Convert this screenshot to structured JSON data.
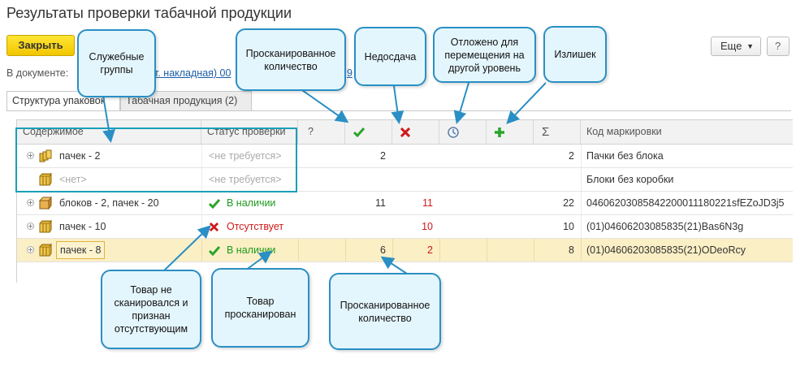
{
  "window": {
    "title": "Результаты проверки табачной продукции"
  },
  "toolbar": {
    "close_label": "Закрыть",
    "more_label": "Еще",
    "help_label": "?"
  },
  "document": {
    "label": "В документе:",
    "link_left": "т. накладная) 00",
    "link_right": "9"
  },
  "tabs": [
    {
      "label": "Структура упаковок"
    },
    {
      "label": "Табачная продукция (2)"
    }
  ],
  "table": {
    "headers": {
      "content": "Содержимое",
      "status": "Статус проверки",
      "unknown": "?",
      "sum": "Σ",
      "code": "Код маркировки"
    },
    "rows": [
      {
        "content": "пачек -  2",
        "status": "<не требуется>",
        "scanned": "2",
        "shortage": "",
        "total": "2",
        "code": "Пачки без блока",
        "status_kind": "grey"
      },
      {
        "content": "<нет>",
        "status": "<не требуется>",
        "scanned": "",
        "shortage": "",
        "total": "",
        "code": "Блоки без коробки",
        "status_kind": "grey"
      },
      {
        "content": "блоков - 2, пачек -  20",
        "status": "В наличии",
        "scanned": "11",
        "shortage": "11",
        "total": "22",
        "code": "04606203085842200011180221sfEZoJD3j5",
        "status_kind": "ok"
      },
      {
        "content": "пачек -  10",
        "status": "Отсутствует",
        "scanned": "",
        "shortage": "10",
        "total": "10",
        "code": "(01)04606203085835(21)Bas6N3g",
        "status_kind": "missing"
      },
      {
        "content": "пачек -  8",
        "status": "В наличии",
        "scanned": "6",
        "shortage": "2",
        "total": "8",
        "code": "(01)04606203085835(21)ODeoRcy",
        "status_kind": "ok"
      }
    ]
  },
  "callouts": {
    "service_groups": "Служебные группы",
    "scanned_qty_top": "Просканированное количество",
    "shortage": "Недосдача",
    "postponed": "Отложено для перемещения на другой уровень",
    "surplus": "Излишек",
    "not_scanned": "Товар не сканировался и признан отсутствующим",
    "scanned": "Товар просканирован",
    "scanned_qty_bottom": "Просканированное количество"
  },
  "colors": {
    "accent_yellow": "#f5cc00",
    "ok_green": "#1e9a1e",
    "missing_red": "#d01818",
    "callout_border": "#2a8fc4",
    "highlight": "#1a9fb8",
    "selected_row": "#fbefc5"
  },
  "icons": {
    "ok": "check-icon",
    "missing": "cross-icon",
    "postponed": "clock-icon",
    "surplus": "plus-icon"
  }
}
